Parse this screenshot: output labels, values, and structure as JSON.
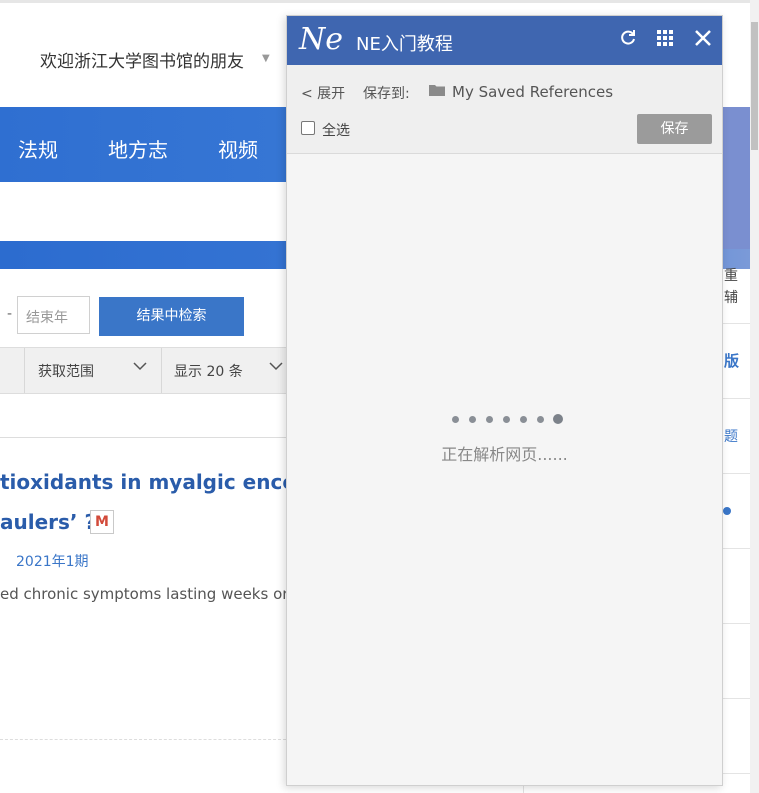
{
  "page": {
    "welcome_text": "欢迎浙江大学图书馆的朋友",
    "nav_items": [
      "法规",
      "地方志",
      "视频"
    ],
    "year_end_placeholder": "结束年",
    "year_dash": "-",
    "search_in_results_label": "结果中检索",
    "filters": [
      {
        "label": "获取范围"
      },
      {
        "label": "显示 20 条"
      }
    ],
    "result": {
      "title_line1": "tioxidants in myalgic enceph",
      "title_line2": "aulers’ ?",
      "badge": "M",
      "issue": "2021年1期",
      "snippet": "ed chronic symptoms lasting weeks or m"
    },
    "right_column": {
      "text_1": "重",
      "text_2": "辅",
      "link_1": "版",
      "link_2": "题"
    }
  },
  "ne_panel": {
    "logo": "Ne",
    "title": "NE入门教程",
    "expand_label": "< 展开",
    "save_to_label": "保存到:",
    "folder_name": "My Saved References",
    "select_all_label": "全选",
    "save_button_label": "保存",
    "loading_text": "正在解析网页......",
    "icons": [
      "refresh-icon",
      "grid-icon",
      "close-icon",
      "folder-icon"
    ]
  },
  "colors": {
    "ne_header": "#3f66b0",
    "nav_blue": "#2f6fd1",
    "link_blue": "#2a5caa",
    "button_blue": "#3a76c8",
    "save_grey": "#9b9b9b"
  }
}
